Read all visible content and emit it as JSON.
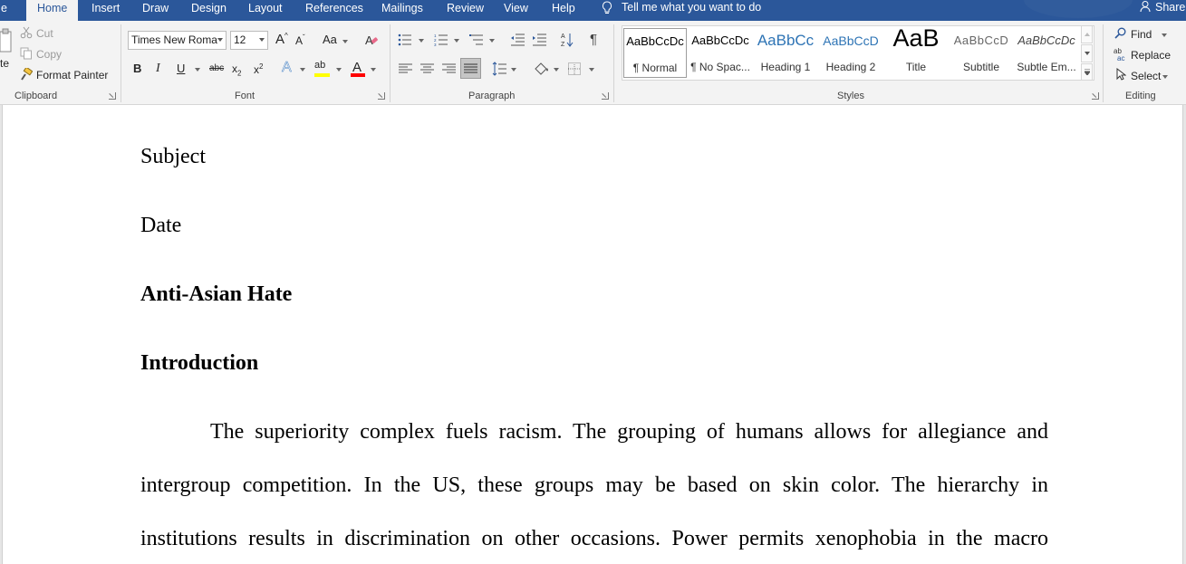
{
  "tabs": {
    "file_partial": "e",
    "items": [
      "Home",
      "Insert",
      "Draw",
      "Design",
      "Layout",
      "References",
      "Mailings",
      "Review",
      "View",
      "Help"
    ],
    "tell_me": "Tell me what you want to do",
    "share": "Share"
  },
  "clipboard": {
    "paste_partial": "te",
    "cut": "Cut",
    "copy": "Copy",
    "format_painter": "Format Painter",
    "label": "Clipboard"
  },
  "font": {
    "name": "Times New Roma",
    "size": "12",
    "change_case": "Aa",
    "label": "Font",
    "highlight_color": "#ffff00",
    "font_color": "#ff0000"
  },
  "paragraph": {
    "label": "Paragraph"
  },
  "styles": {
    "label": "Styles",
    "sample": "AaBbCcDc",
    "items": [
      {
        "sample": "AaBbCcDc",
        "name": "¶ Normal"
      },
      {
        "sample": "AaBbCcDc",
        "name": "¶ No Spac..."
      },
      {
        "sample": "AaBbCc",
        "name": "Heading 1"
      },
      {
        "sample": "AaBbCcD",
        "name": "Heading 2"
      },
      {
        "sample": "AaB",
        "name": "Title"
      },
      {
        "sample": "AaBbCcD",
        "name": "Subtitle"
      },
      {
        "sample": "AaBbCcDc",
        "name": "Subtle Em..."
      }
    ]
  },
  "editing": {
    "find": "Find",
    "replace": "Replace",
    "select": "Select",
    "label": "Editing"
  },
  "document": {
    "subject": "Subject",
    "date": "Date",
    "title": "Anti-Asian Hate",
    "heading": "Introduction",
    "para_lines": [
      "The superiority complex fuels racism. The grouping of humans allows for allegiance and",
      "intergroup competition. In the US, these groups may be based on skin color. The hierarchy in",
      "institutions results in discrimination on other occasions. Power permits xenophobia in the macro"
    ]
  },
  "colors": {
    "accent": "#2b579a",
    "ribbon_bg": "#f3f3f3"
  }
}
